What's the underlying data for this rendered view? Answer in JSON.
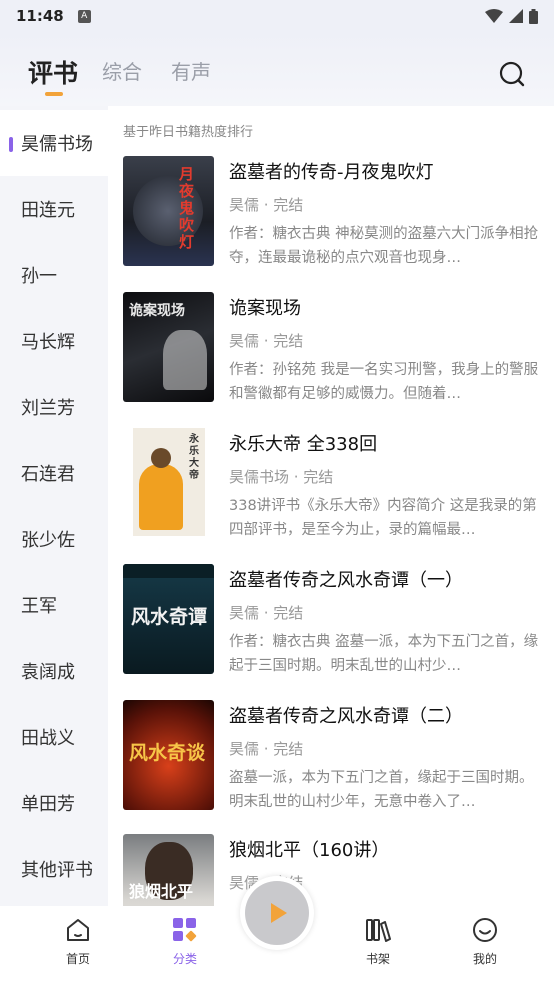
{
  "status_bar": {
    "time": "11:48",
    "badge": "A"
  },
  "header": {
    "tabs": [
      {
        "label": "评书",
        "active": true
      },
      {
        "label": "综合",
        "active": false
      },
      {
        "label": "有声",
        "active": false
      }
    ],
    "search_icon": "search-icon"
  },
  "sidebar": {
    "items": [
      {
        "label": "昊儒书场",
        "active": true
      },
      {
        "label": "田连元"
      },
      {
        "label": "孙一"
      },
      {
        "label": "马长辉"
      },
      {
        "label": "刘兰芳"
      },
      {
        "label": "石连君"
      },
      {
        "label": "张少佐"
      },
      {
        "label": "王军"
      },
      {
        "label": "袁阔成"
      },
      {
        "label": "田战义"
      },
      {
        "label": "单田芳"
      },
      {
        "label": "其他评书"
      }
    ]
  },
  "content": {
    "hint": "基于昨日书籍热度排行",
    "books": [
      {
        "title": "盗墓者的传奇-月夜鬼吹灯",
        "author": "昊儒 · 完结",
        "desc": "作者：糖衣古典 神秘莫测的盗墓六大门派争相抢夺，连最最诡秘的点穴观音也现身…",
        "cover_text": "月夜鬼吹灯"
      },
      {
        "title": "诡案现场",
        "author": "昊儒 · 完结",
        "desc": "作者：孙铭苑 我是一名实习刑警，我身上的警服和警徽都有足够的威慑力。但随着…",
        "cover_text": "诡案现场"
      },
      {
        "title": "永乐大帝 全338回",
        "author": "昊儒书场 · 完结",
        "desc": "338讲评书《永乐大帝》内容简介 这是我录的第四部评书，是至今为止，录的篇幅最…",
        "cover_text": "永乐大帝"
      },
      {
        "title": "盗墓者传奇之风水奇谭（一）",
        "author": "昊儒 · 完结",
        "desc": "作者：糖衣古典 盗墓一派，本为下五门之首，缘起于三国时期。明末乱世的山村少…",
        "cover_text": "风水奇谭"
      },
      {
        "title": "盗墓者传奇之风水奇谭（二）",
        "author": "昊儒 · 完结",
        "desc": "盗墓一派，本为下五门之首，缘起于三国时期。明末乱世的山村少年，无意中卷入了…",
        "cover_text": "风水奇谈"
      },
      {
        "title": "狼烟北平（160讲）",
        "author": "昊儒 · 完结",
        "desc": "",
        "cover_text": "狼烟北平"
      }
    ]
  },
  "bottom_nav": {
    "items": [
      {
        "label": "首页",
        "icon": "home-icon"
      },
      {
        "label": "分类",
        "icon": "category-icon",
        "active": true
      },
      {
        "label": "书架",
        "icon": "bookshelf-icon"
      },
      {
        "label": "我的",
        "icon": "profile-icon"
      }
    ]
  },
  "colors": {
    "accent": "#8a63e8",
    "tab_underline": "#f2a33a",
    "play_fab": "#f2a33a"
  }
}
